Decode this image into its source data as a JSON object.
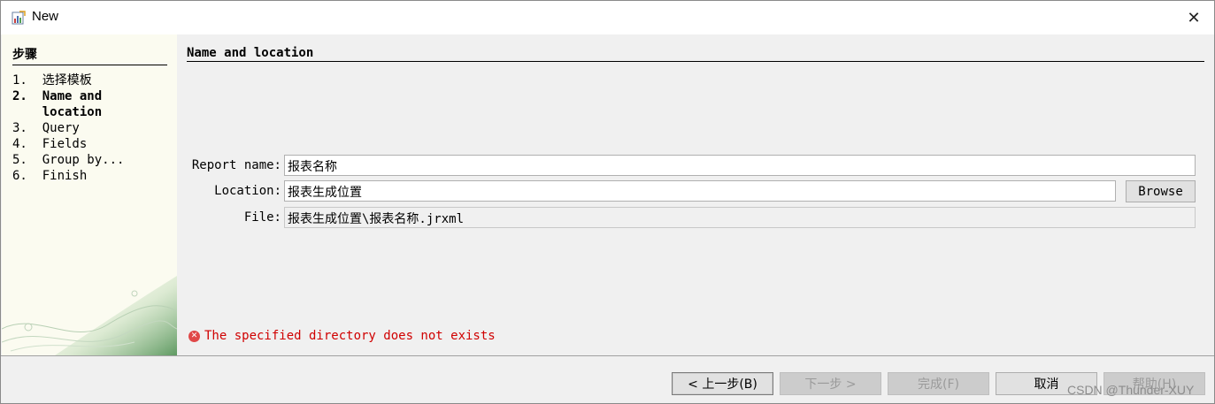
{
  "window": {
    "title": "New",
    "close_glyph": "✕"
  },
  "steps": {
    "heading": "步骤",
    "items": [
      {
        "label": "1.  选择模板"
      },
      {
        "label": "2.  Name and\n    location"
      },
      {
        "label": "3.  Query"
      },
      {
        "label": "4.  Fields"
      },
      {
        "label": "5.  Group by..."
      },
      {
        "label": "6.  Finish"
      }
    ],
    "current_index": 1
  },
  "section": {
    "title": "Name and location"
  },
  "form": {
    "report_name_label": "Report name:",
    "report_name_value": "报表名称",
    "location_label": "Location:",
    "location_value": "报表生成位置",
    "browse_label": "Browse",
    "file_label": "File:",
    "file_value": "报表生成位置\\报表名称.jrxml"
  },
  "error": {
    "icon": "x-circle-icon",
    "message": "The specified directory does not exists"
  },
  "footer": {
    "back_label": "< 上一步(B)",
    "next_label": "下一步 >",
    "finish_label": "完成(F)",
    "cancel_label": "取消",
    "help_label": "帮助(H)",
    "watermark": "CSDN @Thunder-XUY"
  },
  "colors": {
    "error": "#d00000",
    "steps_bg": "#fbfbf0",
    "content_bg": "#f0f0f0"
  }
}
